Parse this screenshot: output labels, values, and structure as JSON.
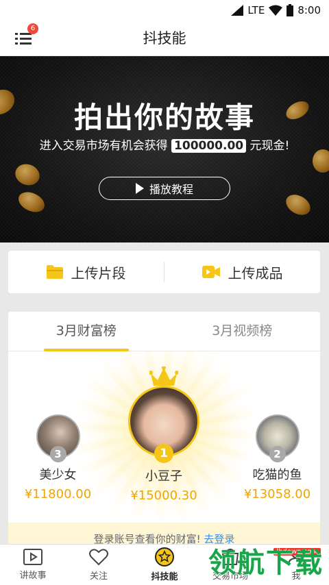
{
  "status_bar": {
    "network": "LTE",
    "time": "8:00"
  },
  "app_bar": {
    "title": "抖技能",
    "menu_badge": "6"
  },
  "banner": {
    "headline": "拍出你的故事",
    "subtitle_prefix": "进入交易市场有机会获得",
    "subtitle_amount": "100000.00",
    "subtitle_suffix": "元现金!",
    "play_button": "播放教程"
  },
  "upload": {
    "clip_label": "上传片段",
    "product_label": "上传成品"
  },
  "ranking": {
    "tabs": [
      {
        "label": "3月财富榜",
        "active": true
      },
      {
        "label": "3月视频榜",
        "active": false
      }
    ],
    "entries": [
      {
        "rank": "2",
        "name": "吃猫的鱼",
        "amount": "¥13058.00"
      },
      {
        "rank": "1",
        "name": "小豆子",
        "amount": "¥15000.30"
      },
      {
        "rank": "3",
        "name": "美少女",
        "amount": "¥11800.00"
      }
    ],
    "login_prompt": "登录账号查看你的财富!",
    "login_link": "去登录"
  },
  "bottom_nav": {
    "items": [
      {
        "label": "讲故事",
        "icon": "video-play-icon"
      },
      {
        "label": "关注",
        "icon": "heart-icon"
      },
      {
        "label": "抖技能",
        "icon": "star-badge-icon",
        "active": true
      },
      {
        "label": "交易市场",
        "icon": "market-icon"
      },
      {
        "label": "我",
        "icon": "user-icon"
      }
    ]
  },
  "watermark": {
    "text": "领航下载",
    "site": "lhdown.com"
  },
  "colors": {
    "accent": "#f5c518",
    "amount": "#f2a400",
    "link": "#3a8ee6"
  }
}
